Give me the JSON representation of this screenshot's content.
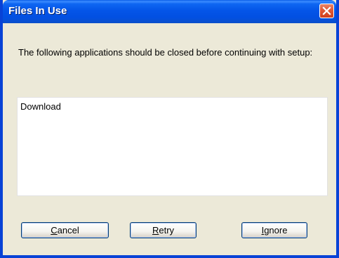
{
  "window": {
    "title": "Files In Use"
  },
  "message": {
    "text": "The following applications should be closed before continuing with setup:"
  },
  "app_list": {
    "items": [
      "Download"
    ]
  },
  "buttons": {
    "cancel": {
      "accel": "C",
      "rest": "ancel"
    },
    "retry": {
      "accel": "R",
      "rest": "etry"
    },
    "ignore": {
      "accel": "I",
      "rest": "gnore"
    }
  },
  "colors": {
    "titlebar": "#0455e8",
    "close_button": "#e35b38",
    "dialog_background": "#ece9d8",
    "list_background": "#ffffff"
  },
  "icons": {
    "close": "close-icon"
  }
}
